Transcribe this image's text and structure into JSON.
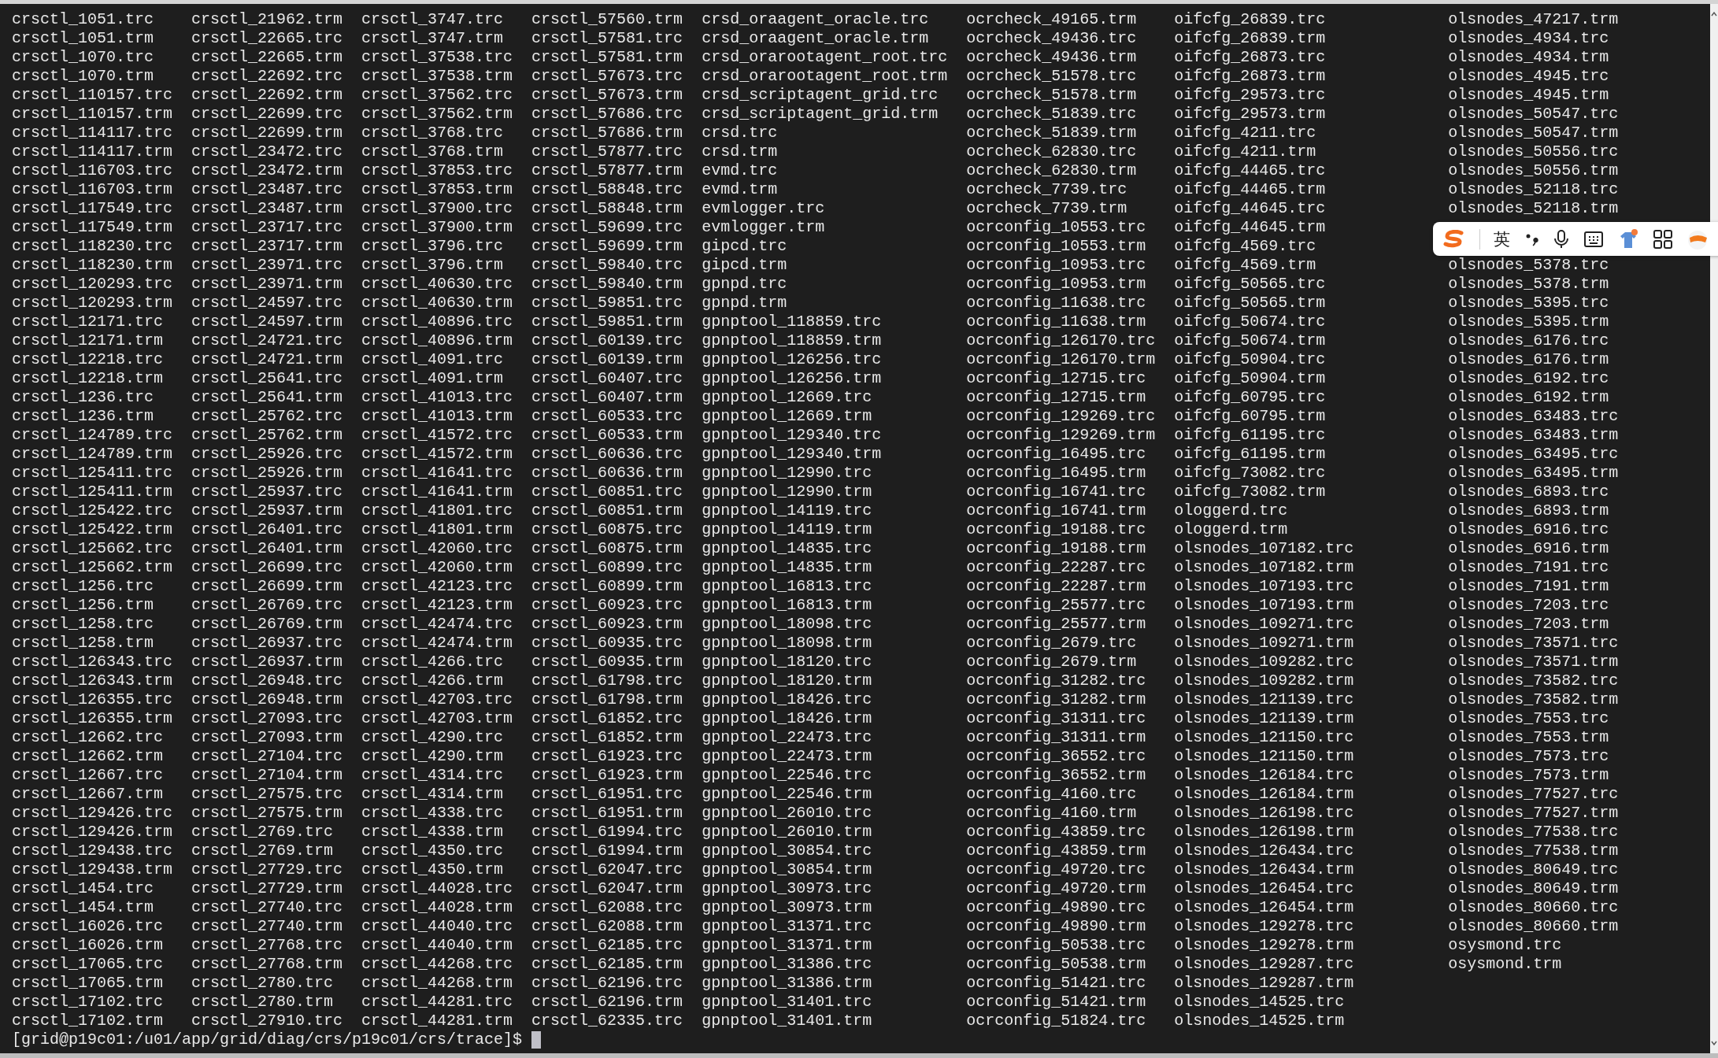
{
  "listing": {
    "columns": [
      {
        "entries": [
          "crsctl_1051.trc",
          "crsctl_1051.trm",
          "crsctl_1070.trc",
          "crsctl_1070.trm",
          "crsctl_110157.trc",
          "crsctl_110157.trm",
          "crsctl_114117.trc",
          "crsctl_114117.trm",
          "crsctl_116703.trc",
          "crsctl_116703.trm",
          "crsctl_117549.trc",
          "crsctl_117549.trm",
          "crsctl_118230.trc",
          "crsctl_118230.trm",
          "crsctl_120293.trc",
          "crsctl_120293.trm",
          "crsctl_12171.trc",
          "crsctl_12171.trm",
          "crsctl_12218.trc",
          "crsctl_12218.trm",
          "crsctl_1236.trc",
          "crsctl_1236.trm",
          "crsctl_124789.trc",
          "crsctl_124789.trm",
          "crsctl_125411.trc",
          "crsctl_125411.trm",
          "crsctl_125422.trc",
          "crsctl_125422.trm",
          "crsctl_125662.trc",
          "crsctl_125662.trm",
          "crsctl_1256.trc",
          "crsctl_1256.trm",
          "crsctl_1258.trc",
          "crsctl_1258.trm",
          "crsctl_126343.trc",
          "crsctl_126343.trm",
          "crsctl_126355.trc",
          "crsctl_126355.trm",
          "crsctl_12662.trc",
          "crsctl_12662.trm",
          "crsctl_12667.trc",
          "crsctl_12667.trm",
          "crsctl_129426.trc",
          "crsctl_129426.trm",
          "crsctl_129438.trc",
          "crsctl_129438.trm",
          "crsctl_1454.trc",
          "crsctl_1454.trm",
          "crsctl_16026.trc",
          "crsctl_16026.trm",
          "crsctl_17065.trc",
          "crsctl_17065.trm",
          "crsctl_17102.trc",
          "crsctl_17102.trm"
        ]
      },
      {
        "entries": [
          "crsctl_21962.trm",
          "crsctl_22665.trc",
          "crsctl_22665.trm",
          "crsctl_22692.trc",
          "crsctl_22692.trm",
          "crsctl_22699.trc",
          "crsctl_22699.trm",
          "crsctl_23472.trc",
          "crsctl_23472.trm",
          "crsctl_23487.trc",
          "crsctl_23487.trm",
          "crsctl_23717.trc",
          "crsctl_23717.trm",
          "crsctl_23971.trc",
          "crsctl_23971.trm",
          "crsctl_24597.trc",
          "crsctl_24597.trm",
          "crsctl_24721.trc",
          "crsctl_24721.trm",
          "crsctl_25641.trc",
          "crsctl_25641.trm",
          "crsctl_25762.trc",
          "crsctl_25762.trm",
          "crsctl_25926.trc",
          "crsctl_25926.trm",
          "crsctl_25937.trc",
          "crsctl_25937.trm",
          "crsctl_26401.trc",
          "crsctl_26401.trm",
          "crsctl_26699.trc",
          "crsctl_26699.trm",
          "crsctl_26769.trc",
          "crsctl_26769.trm",
          "crsctl_26937.trc",
          "crsctl_26937.trm",
          "crsctl_26948.trc",
          "crsctl_26948.trm",
          "crsctl_27093.trc",
          "crsctl_27093.trm",
          "crsctl_27104.trc",
          "crsctl_27104.trm",
          "crsctl_27575.trc",
          "crsctl_27575.trm",
          "crsctl_2769.trc",
          "crsctl_2769.trm",
          "crsctl_27729.trc",
          "crsctl_27729.trm",
          "crsctl_27740.trc",
          "crsctl_27740.trm",
          "crsctl_27768.trc",
          "crsctl_27768.trm",
          "crsctl_2780.trc",
          "crsctl_2780.trm",
          "crsctl_27910.trc"
        ]
      },
      {
        "entries": [
          "crsctl_3747.trc",
          "crsctl_3747.trm",
          "crsctl_37538.trc",
          "crsctl_37538.trm",
          "crsctl_37562.trc",
          "crsctl_37562.trm",
          "crsctl_3768.trc",
          "crsctl_3768.trm",
          "crsctl_37853.trc",
          "crsctl_37853.trm",
          "crsctl_37900.trc",
          "crsctl_37900.trm",
          "crsctl_3796.trc",
          "crsctl_3796.trm",
          "crsctl_40630.trc",
          "crsctl_40630.trm",
          "crsctl_40896.trc",
          "crsctl_40896.trm",
          "crsctl_4091.trc",
          "crsctl_4091.trm",
          "crsctl_41013.trc",
          "crsctl_41013.trm",
          "crsctl_41572.trc",
          "crsctl_41572.trm",
          "crsctl_41641.trc",
          "crsctl_41641.trm",
          "crsctl_41801.trc",
          "crsctl_41801.trm",
          "crsctl_42060.trc",
          "crsctl_42060.trm",
          "crsctl_42123.trc",
          "crsctl_42123.trm",
          "crsctl_42474.trc",
          "crsctl_42474.trm",
          "crsctl_4266.trc",
          "crsctl_4266.trm",
          "crsctl_42703.trc",
          "crsctl_42703.trm",
          "crsctl_4290.trc",
          "crsctl_4290.trm",
          "crsctl_4314.trc",
          "crsctl_4314.trm",
          "crsctl_4338.trc",
          "crsctl_4338.trm",
          "crsctl_4350.trc",
          "crsctl_4350.trm",
          "crsctl_44028.trc",
          "crsctl_44028.trm",
          "crsctl_44040.trc",
          "crsctl_44040.trm",
          "crsctl_44268.trc",
          "crsctl_44268.trm",
          "crsctl_44281.trc",
          "crsctl_44281.trm"
        ]
      },
      {
        "entries": [
          "crsctl_57560.trm",
          "crsctl_57581.trc",
          "crsctl_57581.trm",
          "crsctl_57673.trc",
          "crsctl_57673.trm",
          "crsctl_57686.trc",
          "crsctl_57686.trm",
          "crsctl_57877.trc",
          "crsctl_57877.trm",
          "crsctl_58848.trc",
          "crsctl_58848.trm",
          "crsctl_59699.trc",
          "crsctl_59699.trm",
          "crsctl_59840.trc",
          "crsctl_59840.trm",
          "crsctl_59851.trc",
          "crsctl_59851.trm",
          "crsctl_60139.trc",
          "crsctl_60139.trm",
          "crsctl_60407.trc",
          "crsctl_60407.trm",
          "crsctl_60533.trc",
          "crsctl_60533.trm",
          "crsctl_60636.trc",
          "crsctl_60636.trm",
          "crsctl_60851.trc",
          "crsctl_60851.trm",
          "crsctl_60875.trc",
          "crsctl_60875.trm",
          "crsctl_60899.trc",
          "crsctl_60899.trm",
          "crsctl_60923.trc",
          "crsctl_60923.trm",
          "crsctl_60935.trc",
          "crsctl_60935.trm",
          "crsctl_61798.trc",
          "crsctl_61798.trm",
          "crsctl_61852.trc",
          "crsctl_61852.trm",
          "crsctl_61923.trc",
          "crsctl_61923.trm",
          "crsctl_61951.trc",
          "crsctl_61951.trm",
          "crsctl_61994.trc",
          "crsctl_61994.trm",
          "crsctl_62047.trc",
          "crsctl_62047.trm",
          "crsctl_62088.trc",
          "crsctl_62088.trm",
          "crsctl_62185.trc",
          "crsctl_62185.trm",
          "crsctl_62196.trc",
          "crsctl_62196.trm",
          "crsctl_62335.trc"
        ]
      },
      {
        "entries": [
          "crsd_oraagent_oracle.trc",
          "crsd_oraagent_oracle.trm",
          "crsd_orarootagent_root.trc",
          "crsd_orarootagent_root.trm",
          "crsd_scriptagent_grid.trc",
          "crsd_scriptagent_grid.trm",
          "crsd.trc",
          "crsd.trm",
          "evmd.trc",
          "evmd.trm",
          "evmlogger.trc",
          "evmlogger.trm",
          "gipcd.trc",
          "gipcd.trm",
          "gpnpd.trc",
          "gpnpd.trm",
          "gpnptool_118859.trc",
          "gpnptool_118859.trm",
          "gpnptool_126256.trc",
          "gpnptool_126256.trm",
          "gpnptool_12669.trc",
          "gpnptool_12669.trm",
          "gpnptool_129340.trc",
          "gpnptool_129340.trm",
          "gpnptool_12990.trc",
          "gpnptool_12990.trm",
          "gpnptool_14119.trc",
          "gpnptool_14119.trm",
          "gpnptool_14835.trc",
          "gpnptool_14835.trm",
          "gpnptool_16813.trc",
          "gpnptool_16813.trm",
          "gpnptool_18098.trc",
          "gpnptool_18098.trm",
          "gpnptool_18120.trc",
          "gpnptool_18120.trm",
          "gpnptool_18426.trc",
          "gpnptool_18426.trm",
          "gpnptool_22473.trc",
          "gpnptool_22473.trm",
          "gpnptool_22546.trc",
          "gpnptool_22546.trm",
          "gpnptool_26010.trc",
          "gpnptool_26010.trm",
          "gpnptool_30854.trc",
          "gpnptool_30854.trm",
          "gpnptool_30973.trc",
          "gpnptool_30973.trm",
          "gpnptool_31371.trc",
          "gpnptool_31371.trm",
          "gpnptool_31386.trc",
          "gpnptool_31386.trm",
          "gpnptool_31401.trc",
          "gpnptool_31401.trm"
        ]
      },
      {
        "entries": [
          "ocrcheck_49165.trm",
          "ocrcheck_49436.trc",
          "ocrcheck_49436.trm",
          "ocrcheck_51578.trc",
          "ocrcheck_51578.trm",
          "ocrcheck_51839.trc",
          "ocrcheck_51839.trm",
          "ocrcheck_62830.trc",
          "ocrcheck_62830.trm",
          "ocrcheck_7739.trc",
          "ocrcheck_7739.trm",
          "ocrconfig_10553.trc",
          "ocrconfig_10553.trm",
          "ocrconfig_10953.trc",
          "ocrconfig_10953.trm",
          "ocrconfig_11638.trc",
          "ocrconfig_11638.trm",
          "ocrconfig_126170.trc",
          "ocrconfig_126170.trm",
          "ocrconfig_12715.trc",
          "ocrconfig_12715.trm",
          "ocrconfig_129269.trc",
          "ocrconfig_129269.trm",
          "ocrconfig_16495.trc",
          "ocrconfig_16495.trm",
          "ocrconfig_16741.trc",
          "ocrconfig_16741.trm",
          "ocrconfig_19188.trc",
          "ocrconfig_19188.trm",
          "ocrconfig_22287.trc",
          "ocrconfig_22287.trm",
          "ocrconfig_25577.trc",
          "ocrconfig_25577.trm",
          "ocrconfig_2679.trc",
          "ocrconfig_2679.trm",
          "ocrconfig_31282.trc",
          "ocrconfig_31282.trm",
          "ocrconfig_31311.trc",
          "ocrconfig_31311.trm",
          "ocrconfig_36552.trc",
          "ocrconfig_36552.trm",
          "ocrconfig_4160.trc",
          "ocrconfig_4160.trm",
          "ocrconfig_43859.trc",
          "ocrconfig_43859.trm",
          "ocrconfig_49720.trc",
          "ocrconfig_49720.trm",
          "ocrconfig_49890.trc",
          "ocrconfig_49890.trm",
          "ocrconfig_50538.trc",
          "ocrconfig_50538.trm",
          "ocrconfig_51421.trc",
          "ocrconfig_51421.trm",
          "ocrconfig_51824.trc"
        ]
      },
      {
        "entries": [
          "oifcfg_26839.trc",
          "oifcfg_26839.trm",
          "oifcfg_26873.trc",
          "oifcfg_26873.trm",
          "oifcfg_29573.trc",
          "oifcfg_29573.trm",
          "oifcfg_4211.trc",
          "oifcfg_4211.trm",
          "oifcfg_44465.trc",
          "oifcfg_44465.trm",
          "oifcfg_44645.trc",
          "oifcfg_44645.trm",
          "oifcfg_4569.trc",
          "oifcfg_4569.trm",
          "oifcfg_50565.trc",
          "oifcfg_50565.trm",
          "oifcfg_50674.trc",
          "oifcfg_50674.trm",
          "oifcfg_50904.trc",
          "oifcfg_50904.trm",
          "oifcfg_60795.trc",
          "oifcfg_60795.trm",
          "oifcfg_61195.trc",
          "oifcfg_61195.trm",
          "oifcfg_73082.trc",
          "oifcfg_73082.trm",
          "ologgerd.trc",
          "ologgerd.trm",
          "olsnodes_107182.trc",
          "olsnodes_107182.trm",
          "olsnodes_107193.trc",
          "olsnodes_107193.trm",
          "olsnodes_109271.trc",
          "olsnodes_109271.trm",
          "olsnodes_109282.trc",
          "olsnodes_109282.trm",
          "olsnodes_121139.trc",
          "olsnodes_121139.trm",
          "olsnodes_121150.trc",
          "olsnodes_121150.trm",
          "olsnodes_126184.trc",
          "olsnodes_126184.trm",
          "olsnodes_126198.trc",
          "olsnodes_126198.trm",
          "olsnodes_126434.trc",
          "olsnodes_126434.trm",
          "olsnodes_126454.trc",
          "olsnodes_126454.trm",
          "olsnodes_129278.trc",
          "olsnodes_129278.trm",
          "olsnodes_129287.trc",
          "olsnodes_129287.trm",
          "olsnodes_14525.trc",
          "olsnodes_14525.trm"
        ]
      },
      {
        "entries": [
          "olsnodes_47217.trm",
          "olsnodes_4934.trc",
          "olsnodes_4934.trm",
          "olsnodes_4945.trc",
          "olsnodes_4945.trm",
          "olsnodes_50547.trc",
          "olsnodes_50547.trm",
          "olsnodes_50556.trc",
          "olsnodes_50556.trm",
          "olsnodes_52118.trc",
          "olsnodes_52118.trm"
        ],
        "entries_below_toolbar": [
          "olsnodes_5378.trc",
          "olsnodes_5378.trm",
          "olsnodes_5395.trc",
          "olsnodes_5395.trm",
          "olsnodes_6176.trc",
          "olsnodes_6176.trm",
          "olsnodes_6192.trc",
          "olsnodes_6192.trm",
          "olsnodes_63483.trc",
          "olsnodes_63483.trm",
          "olsnodes_63495.trc",
          "olsnodes_63495.trm",
          "olsnodes_6893.trc",
          "olsnodes_6893.trm",
          "olsnodes_6916.trc",
          "olsnodes_6916.trm",
          "olsnodes_7191.trc",
          "olsnodes_7191.trm",
          "olsnodes_7203.trc",
          "olsnodes_7203.trm",
          "olsnodes_73571.trc",
          "olsnodes_73571.trm",
          "olsnodes_73582.trc",
          "olsnodes_73582.trm",
          "olsnodes_7553.trc",
          "olsnodes_7553.trm",
          "olsnodes_7573.trc",
          "olsnodes_7573.trm",
          "olsnodes_77527.trc",
          "olsnodes_77527.trm",
          "olsnodes_77538.trc",
          "olsnodes_77538.trm",
          "olsnodes_80649.trc",
          "olsnodes_80649.trm",
          "olsnodes_80660.trc",
          "olsnodes_80660.trm",
          "osysmond.trc",
          "osysmond.trm"
        ]
      }
    ]
  },
  "prompt": "[grid@p19c01:/u01/app/grid/diag/crs/p19c01/crs/trace]$",
  "ime_toolbar": {
    "mode_label": "英"
  }
}
